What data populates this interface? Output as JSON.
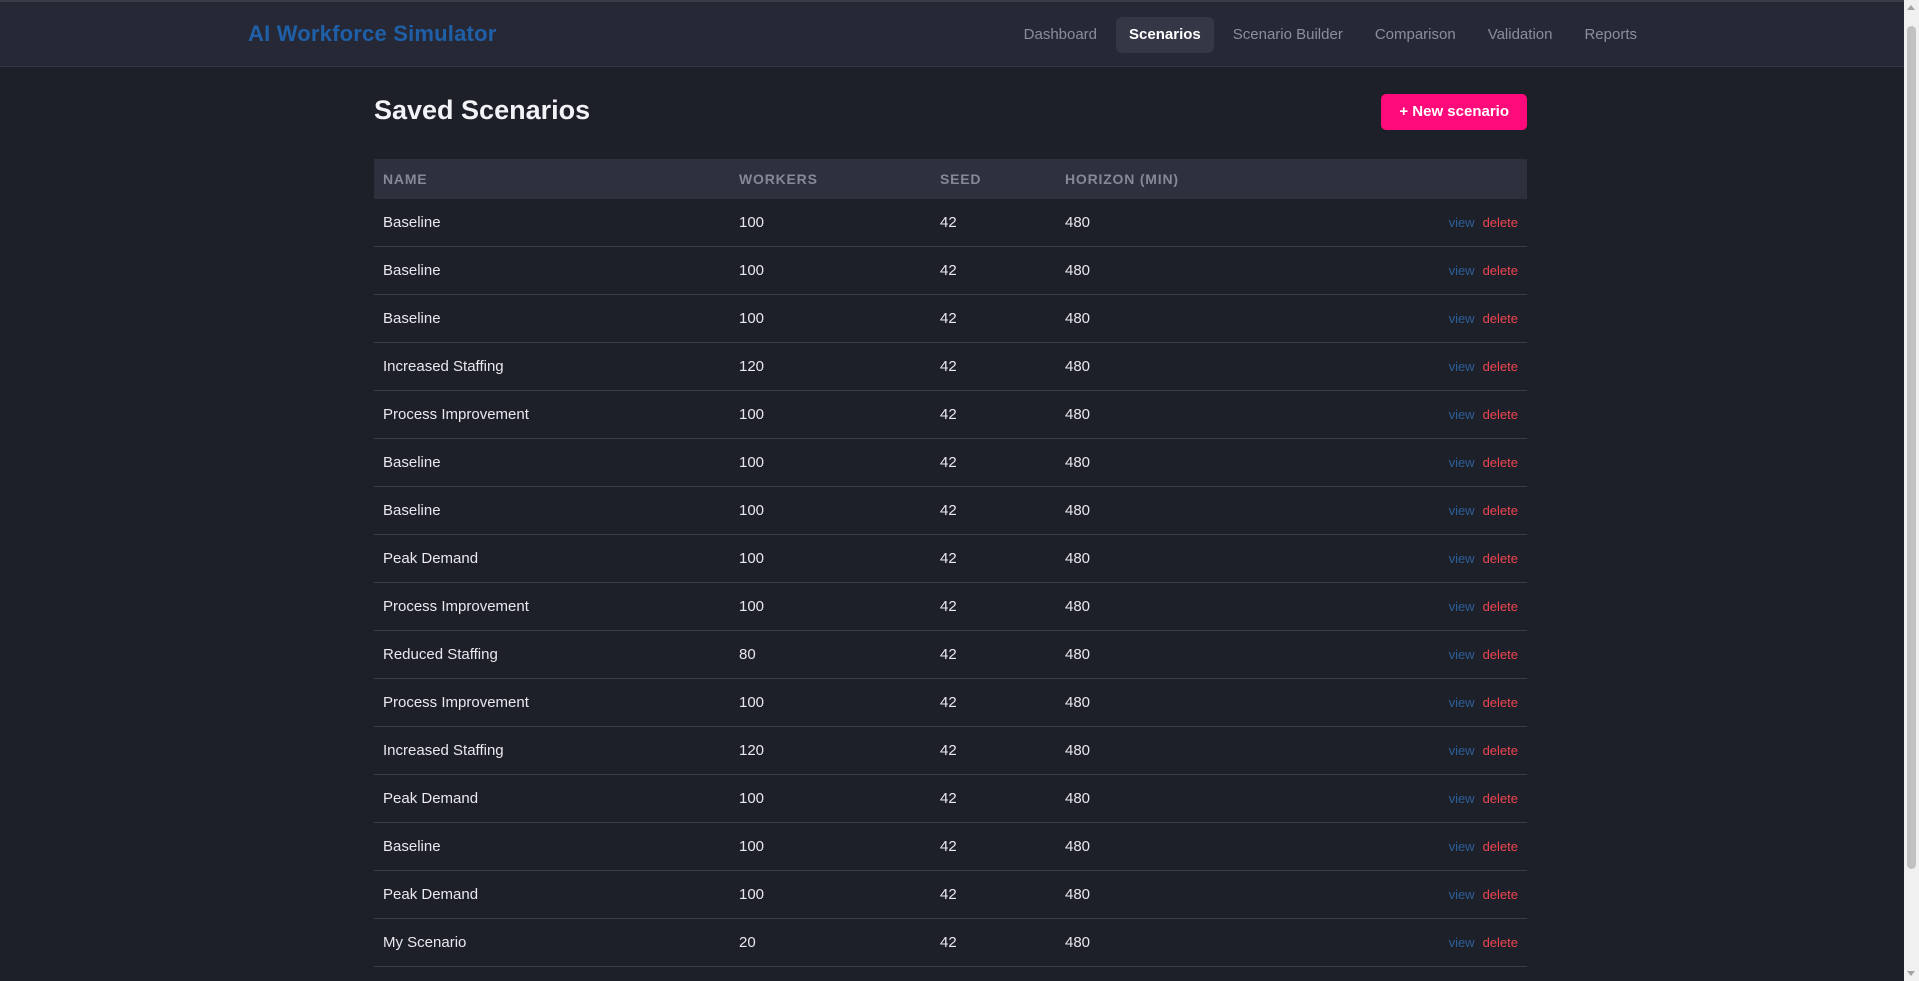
{
  "app": {
    "title": "AI Workforce Simulator"
  },
  "nav": {
    "items": [
      {
        "label": "Dashboard",
        "active": false
      },
      {
        "label": "Scenarios",
        "active": true
      },
      {
        "label": "Scenario Builder",
        "active": false
      },
      {
        "label": "Comparison",
        "active": false
      },
      {
        "label": "Validation",
        "active": false
      },
      {
        "label": "Reports",
        "active": false
      }
    ]
  },
  "page": {
    "title": "Saved Scenarios",
    "new_button_label": "+ New scenario"
  },
  "table": {
    "headers": {
      "name": "NAME",
      "workers": "WORKERS",
      "seed": "SEED",
      "horizon": "HORIZON (MIN)"
    },
    "view_label": "view",
    "delete_label": "delete",
    "rows": [
      {
        "name": "Baseline",
        "workers": "100",
        "seed": "42",
        "horizon": "480"
      },
      {
        "name": "Baseline",
        "workers": "100",
        "seed": "42",
        "horizon": "480"
      },
      {
        "name": "Baseline",
        "workers": "100",
        "seed": "42",
        "horizon": "480"
      },
      {
        "name": "Increased Staffing",
        "workers": "120",
        "seed": "42",
        "horizon": "480"
      },
      {
        "name": "Process Improvement",
        "workers": "100",
        "seed": "42",
        "horizon": "480"
      },
      {
        "name": "Baseline",
        "workers": "100",
        "seed": "42",
        "horizon": "480"
      },
      {
        "name": "Baseline",
        "workers": "100",
        "seed": "42",
        "horizon": "480"
      },
      {
        "name": "Peak Demand",
        "workers": "100",
        "seed": "42",
        "horizon": "480"
      },
      {
        "name": "Process Improvement",
        "workers": "100",
        "seed": "42",
        "horizon": "480"
      },
      {
        "name": "Reduced Staffing",
        "workers": "80",
        "seed": "42",
        "horizon": "480"
      },
      {
        "name": "Process Improvement",
        "workers": "100",
        "seed": "42",
        "horizon": "480"
      },
      {
        "name": "Increased Staffing",
        "workers": "120",
        "seed": "42",
        "horizon": "480"
      },
      {
        "name": "Peak Demand",
        "workers": "100",
        "seed": "42",
        "horizon": "480"
      },
      {
        "name": "Baseline",
        "workers": "100",
        "seed": "42",
        "horizon": "480"
      },
      {
        "name": "Peak Demand",
        "workers": "100",
        "seed": "42",
        "horizon": "480"
      },
      {
        "name": "My Scenario",
        "workers": "20",
        "seed": "42",
        "horizon": "480"
      }
    ]
  },
  "colors": {
    "brand": "#1f5fa8",
    "accent": "#ff0a7a",
    "view_link": "#2a5f97",
    "delete_link": "#ef4451"
  }
}
